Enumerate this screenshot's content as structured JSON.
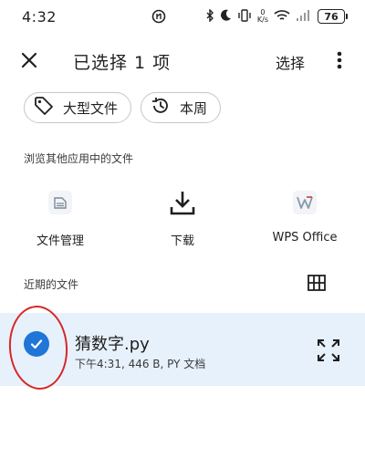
{
  "status_bar": {
    "time": "4:32",
    "net_speed_value": "0",
    "net_speed_unit": "K/s",
    "battery": "76"
  },
  "app_bar": {
    "title": "已选择 1 项",
    "select_label": "选择"
  },
  "chips": [
    {
      "label": "大型文件",
      "icon": "tag-icon"
    },
    {
      "label": "本周",
      "icon": "history-icon"
    }
  ],
  "browse_section": {
    "label": "浏览其他应用中的文件",
    "apps": [
      {
        "label": "文件管理",
        "icon": "file-manager-icon"
      },
      {
        "label": "下载",
        "icon": "download-icon"
      },
      {
        "label": "WPS Office",
        "icon": "wps-office-icon"
      }
    ]
  },
  "recent_section": {
    "label": "近期的文件"
  },
  "files": [
    {
      "name": "猜数字.py",
      "meta": "下午4:31, 446 B, PY 文档",
      "selected": true
    }
  ],
  "colors": {
    "accent": "#1f75d8",
    "selected_row": "#e7f1fb",
    "annotation": "#d62828"
  }
}
